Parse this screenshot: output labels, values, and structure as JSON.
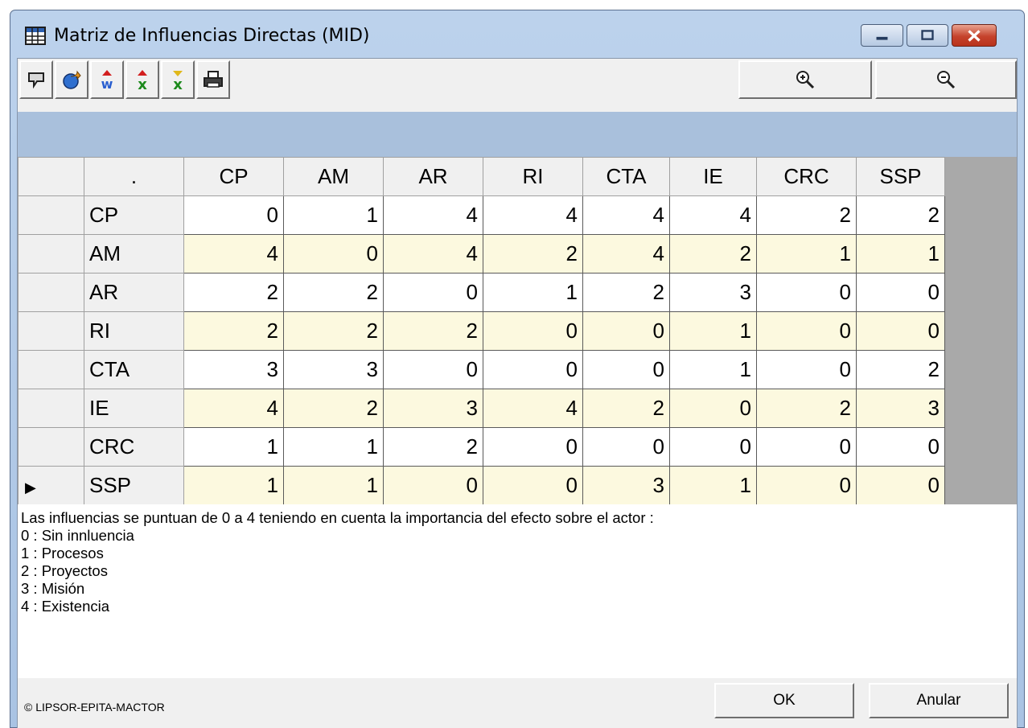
{
  "window": {
    "title": "Matriz de Influencias Directas (MID)"
  },
  "toolbar": {
    "icons": [
      "chat-icon",
      "export-icon",
      "actor-w-icon",
      "actor-up-icon",
      "actor-down-icon",
      "print-icon",
      "zoom-in-icon",
      "zoom-out-icon"
    ]
  },
  "matrix": {
    "corner": ".",
    "columns": [
      "CP",
      "AM",
      "AR",
      "RI",
      "CTA",
      "IE",
      "CRC",
      "SSP"
    ],
    "rows": [
      {
        "name": "CP",
        "values": [
          "0",
          "1",
          "4",
          "4",
          "4",
          "4",
          "2",
          "2"
        ]
      },
      {
        "name": "AM",
        "values": [
          "4",
          "0",
          "4",
          "2",
          "4",
          "2",
          "1",
          "1"
        ]
      },
      {
        "name": "AR",
        "values": [
          "2",
          "2",
          "0",
          "1",
          "2",
          "3",
          "0",
          "0"
        ]
      },
      {
        "name": "RI",
        "values": [
          "2",
          "2",
          "2",
          "0",
          "0",
          "1",
          "0",
          "0"
        ]
      },
      {
        "name": "CTA",
        "values": [
          "3",
          "3",
          "0",
          "0",
          "0",
          "1",
          "0",
          "2"
        ]
      },
      {
        "name": "IE",
        "values": [
          "4",
          "2",
          "3",
          "4",
          "2",
          "0",
          "2",
          "3"
        ]
      },
      {
        "name": "CRC",
        "values": [
          "1",
          "1",
          "2",
          "0",
          "0",
          "0",
          "0",
          "0"
        ]
      },
      {
        "name": "SSP",
        "values": [
          "1",
          "1",
          "0",
          "0",
          "3",
          "1",
          "0",
          "0"
        ]
      }
    ],
    "current_row_marker": "▶"
  },
  "legend": {
    "intro": "Las influencias se puntuan de 0 a 4 teniendo en cuenta la importancia del efecto sobre el actor :",
    "items": [
      "0 : Sin innluencia",
      "1 : Procesos",
      "2 : Proyectos",
      "3 : Misión",
      "4 : Existencia"
    ]
  },
  "footer": {
    "copyright": "© LIPSOR-EPITA-MACTOR",
    "ok_label": "OK",
    "cancel_label": "Anular"
  }
}
